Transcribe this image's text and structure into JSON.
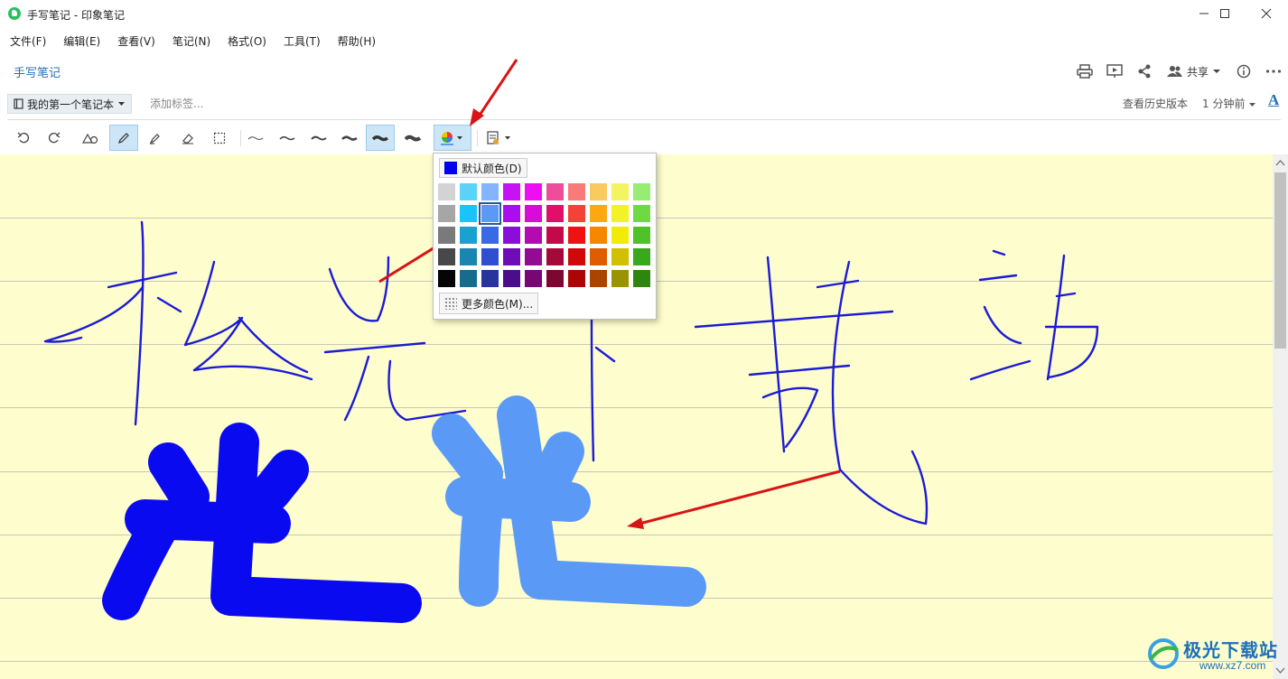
{
  "window": {
    "title": "手写笔记 - 印象笔记"
  },
  "menu": [
    "文件(F)",
    "编辑(E)",
    "查看(V)",
    "笔记(N)",
    "格式(O)",
    "工具(T)",
    "帮助(H)"
  ],
  "note": {
    "title": "手写笔记",
    "notebook": "我的第一个笔记本",
    "tag_placeholder": "添加标签...",
    "history": "查看历史版本",
    "time": "1 分钟前",
    "font_button": "A",
    "share_label": "共享"
  },
  "palette": {
    "default_label": "默认颜色(D)",
    "default_color": "#0000ee",
    "more_label": "更多颜色(M)...",
    "selected": [
      1,
      2
    ],
    "rows": [
      [
        "#d3d3d3",
        "#5ad2fa",
        "#84b4ff",
        "#c613f5",
        "#ef0ef4",
        "#ed4d9b",
        "#fa7a7a",
        "#fac95f",
        "#f4f462",
        "#97ec73"
      ],
      [
        "#a6a6a6",
        "#19c4f8",
        "#5b99f7",
        "#a90ef0",
        "#d90bd9",
        "#e10e6a",
        "#f44336",
        "#fea811",
        "#f2f226",
        "#6fd944"
      ],
      [
        "#7a7a7a",
        "#1aa1cf",
        "#3a69e6",
        "#8a0ed8",
        "#b20bb2",
        "#c4094b",
        "#ee1212",
        "#f58800",
        "#f1eb05",
        "#4fc129"
      ],
      [
        "#484848",
        "#1b85b2",
        "#2f4ed0",
        "#6e0cb7",
        "#930b93",
        "#a30939",
        "#d10808",
        "#de5d00",
        "#d0c000",
        "#3aa81c"
      ],
      [
        "#050505",
        "#176b8f",
        "#27349e",
        "#4b0d8c",
        "#760773",
        "#7e0732",
        "#ad0505",
        "#ab4301",
        "#999402",
        "#2e8611"
      ]
    ]
  },
  "accent_color": "#2671b8",
  "canvas_color": "#fefdcd",
  "ink_colors": {
    "thin": "#1b1bd6",
    "bold_dark": "#0a0af0",
    "bold_light": "#5b99f7"
  },
  "annotation_color": "#d81414",
  "watermark": {
    "text": "极光下载站",
    "url": "www.xz7.com"
  }
}
